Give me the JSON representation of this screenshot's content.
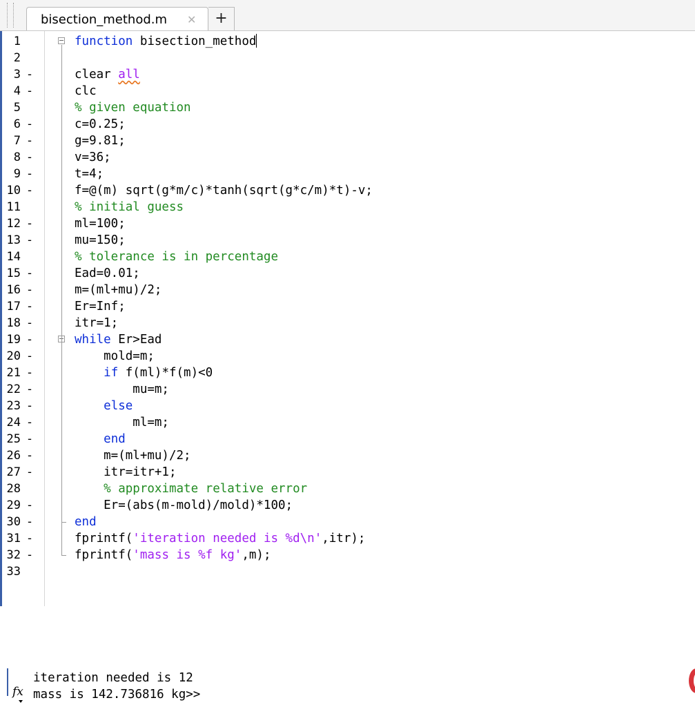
{
  "tab": {
    "title": "bisection_method.m",
    "close_glyph": "✕",
    "add_glyph": "+"
  },
  "code_lines": [
    {
      "num": "1",
      "bp": "",
      "tokens": [
        {
          "t": "function",
          "c": "kw"
        },
        {
          "t": " bisection_method"
        }
      ]
    },
    {
      "num": "2",
      "bp": "",
      "tokens": []
    },
    {
      "num": "3",
      "bp": "-",
      "tokens": [
        {
          "t": "clear "
        },
        {
          "t": "all",
          "c": "warn"
        }
      ]
    },
    {
      "num": "4",
      "bp": "-",
      "tokens": [
        {
          "t": "clc"
        }
      ]
    },
    {
      "num": "5",
      "bp": "",
      "tokens": [
        {
          "t": "% given equation",
          "c": "cm"
        }
      ]
    },
    {
      "num": "6",
      "bp": "-",
      "tokens": [
        {
          "t": "c=0.25;"
        }
      ]
    },
    {
      "num": "7",
      "bp": "-",
      "tokens": [
        {
          "t": "g=9.81;"
        }
      ]
    },
    {
      "num": "8",
      "bp": "-",
      "tokens": [
        {
          "t": "v=36;"
        }
      ]
    },
    {
      "num": "9",
      "bp": "-",
      "tokens": [
        {
          "t": "t=4;"
        }
      ]
    },
    {
      "num": "10",
      "bp": "-",
      "tokens": [
        {
          "t": "f=@(m) sqrt(g*m/c)*tanh(sqrt(g*c/m)*t)-v;"
        }
      ]
    },
    {
      "num": "11",
      "bp": "",
      "tokens": [
        {
          "t": "% initial guess",
          "c": "cm"
        }
      ]
    },
    {
      "num": "12",
      "bp": "-",
      "tokens": [
        {
          "t": "ml=100;"
        }
      ]
    },
    {
      "num": "13",
      "bp": "-",
      "tokens": [
        {
          "t": "mu=150;"
        }
      ]
    },
    {
      "num": "14",
      "bp": "",
      "tokens": [
        {
          "t": "% tolerance is in percentage",
          "c": "cm"
        }
      ]
    },
    {
      "num": "15",
      "bp": "-",
      "tokens": [
        {
          "t": "Ead=0.01;"
        }
      ]
    },
    {
      "num": "16",
      "bp": "-",
      "tokens": [
        {
          "t": "m=(ml+mu)/2;"
        }
      ]
    },
    {
      "num": "17",
      "bp": "-",
      "tokens": [
        {
          "t": "Er=Inf;"
        }
      ]
    },
    {
      "num": "18",
      "bp": "-",
      "tokens": [
        {
          "t": "itr=1;"
        }
      ]
    },
    {
      "num": "19",
      "bp": "-",
      "tokens": [
        {
          "t": "while",
          "c": "kw"
        },
        {
          "t": " Er>Ead"
        }
      ]
    },
    {
      "num": "20",
      "bp": "-",
      "tokens": [
        {
          "t": "    mold=m;"
        }
      ]
    },
    {
      "num": "21",
      "bp": "-",
      "tokens": [
        {
          "t": "    "
        },
        {
          "t": "if",
          "c": "kw"
        },
        {
          "t": " f(ml)*f(m)<0"
        }
      ]
    },
    {
      "num": "22",
      "bp": "-",
      "tokens": [
        {
          "t": "        mu=m;"
        }
      ]
    },
    {
      "num": "23",
      "bp": "-",
      "tokens": [
        {
          "t": "    "
        },
        {
          "t": "else",
          "c": "kw"
        }
      ]
    },
    {
      "num": "24",
      "bp": "-",
      "tokens": [
        {
          "t": "        ml=m;"
        }
      ]
    },
    {
      "num": "25",
      "bp": "-",
      "tokens": [
        {
          "t": "    "
        },
        {
          "t": "end",
          "c": "kw"
        }
      ]
    },
    {
      "num": "26",
      "bp": "-",
      "tokens": [
        {
          "t": "    m=(ml+mu)/2;"
        }
      ]
    },
    {
      "num": "27",
      "bp": "-",
      "tokens": [
        {
          "t": "    itr=itr+1;"
        }
      ]
    },
    {
      "num": "28",
      "bp": "",
      "tokens": [
        {
          "t": "    "
        },
        {
          "t": "% approximate relative error",
          "c": "cm"
        }
      ]
    },
    {
      "num": "29",
      "bp": "-",
      "tokens": [
        {
          "t": "    Er=(abs(m-mold)/mold)*100;"
        }
      ]
    },
    {
      "num": "30",
      "bp": "-",
      "tokens": [
        {
          "t": "end",
          "c": "kw"
        }
      ]
    },
    {
      "num": "31",
      "bp": "-",
      "tokens": [
        {
          "t": "fprintf("
        },
        {
          "t": "'iteration needed is %d\\n'",
          "c": "str"
        },
        {
          "t": ",itr);"
        }
      ]
    },
    {
      "num": "32",
      "bp": "-",
      "tokens": [
        {
          "t": "fprintf("
        },
        {
          "t": "'mass is %f kg'",
          "c": "str"
        },
        {
          "t": ",m);"
        }
      ]
    },
    {
      "num": "33",
      "bp": "",
      "tokens": []
    }
  ],
  "command_window": {
    "line1": "iteration needed is 12",
    "line2": "mass is 142.736816 kg>>",
    "prompt_icon": "fx-icon"
  },
  "colors": {
    "keyword": "#0e2fd8",
    "comment": "#228b22",
    "string": "#a020f0",
    "warning_underline": "#e87722"
  }
}
